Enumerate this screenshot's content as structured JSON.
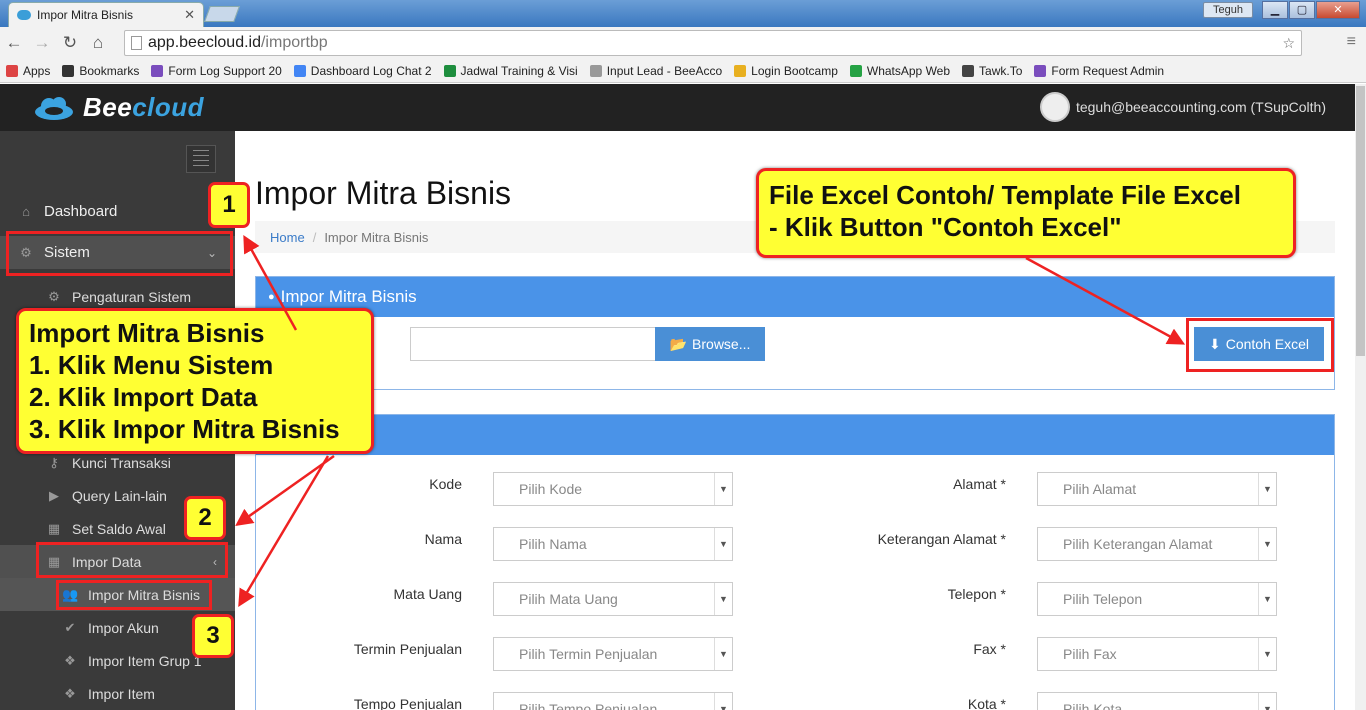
{
  "browser": {
    "tab_title": "Impor Mitra Bisnis",
    "tab_close": "✕",
    "window_user": "Teguh",
    "url_host": "app.beecloud.id",
    "url_path": "/importbp",
    "bookmarks": [
      {
        "label": "Apps",
        "icon": "apps-icon",
        "color": "#d44"
      },
      {
        "label": "Bookmarks",
        "icon": "star-icon",
        "color": "#333"
      },
      {
        "label": "Form Log Support 20",
        "icon": "form-icon",
        "color": "#7a4dbd"
      },
      {
        "label": "Dashboard Log Chat 2",
        "icon": "google-icon",
        "color": "#4285f4"
      },
      {
        "label": "Jadwal Training & Visi",
        "icon": "sheet-icon",
        "color": "#1e8e3e"
      },
      {
        "label": "Input Lead - BeeAcco",
        "icon": "page-icon",
        "color": "#999"
      },
      {
        "label": "Login Bootcamp",
        "icon": "hand-icon",
        "color": "#e8b020"
      },
      {
        "label": "WhatsApp Web",
        "icon": "whatsapp-icon",
        "color": "#25a244"
      },
      {
        "label": "Tawk.To",
        "icon": "bird-icon",
        "color": "#444"
      },
      {
        "label": "Form Request Admin",
        "icon": "form-icon",
        "color": "#7a4dbd"
      }
    ]
  },
  "app": {
    "logo_prefix": "Bee",
    "logo_suffix": "cloud",
    "user_email": "teguh@beeaccounting.com (TSupColth)"
  },
  "sidebar": {
    "items": [
      {
        "label": "Dashboard",
        "icon": "home-icon"
      },
      {
        "label": "Sistem",
        "icon": "gears-icon"
      },
      {
        "label": "Pengaturan Sistem",
        "icon": "gear-icon"
      },
      {
        "label": "Kunci Transaksi",
        "icon": "key-icon"
      },
      {
        "label": "Query Lain-lain",
        "icon": "play-icon"
      },
      {
        "label": "Set Saldo Awal",
        "icon": "table-icon"
      },
      {
        "label": "Impor Data",
        "icon": "table-icon"
      },
      {
        "label": "Impor Mitra Bisnis",
        "icon": "users-icon"
      },
      {
        "label": "Impor Akun",
        "icon": "check-icon"
      },
      {
        "label": "Impor Item Grup 1",
        "icon": "cubes-icon"
      },
      {
        "label": "Impor Item",
        "icon": "cubes-icon"
      }
    ]
  },
  "main": {
    "title": "Impor Mitra Bisnis",
    "breadcrumb_home": "Home",
    "breadcrumb_sep": "/",
    "breadcrumb_current": "Impor Mitra Bisnis",
    "panel_title": "Impor Mitra Bisnis",
    "browse_label": "Browse...",
    "contoh_label": "Contoh Excel",
    "fields_left": [
      {
        "label": "Kode",
        "placeholder": "Pilih Kode"
      },
      {
        "label": "Nama",
        "placeholder": "Pilih Nama"
      },
      {
        "label": "Mata Uang",
        "placeholder": "Pilih Mata Uang"
      },
      {
        "label": "Termin Penjualan",
        "placeholder": "Pilih Termin Penjualan"
      },
      {
        "label": "Tempo Penjualan",
        "placeholder": "Pilih Tempo Penjualan"
      }
    ],
    "fields_right": [
      {
        "label": "Alamat *",
        "placeholder": "Pilih Alamat"
      },
      {
        "label": "Keterangan Alamat *",
        "placeholder": "Pilih Keterangan Alamat"
      },
      {
        "label": "Telepon *",
        "placeholder": "Pilih Telepon"
      },
      {
        "label": "Fax *",
        "placeholder": "Pilih Fax"
      },
      {
        "label": "Kota *",
        "placeholder": "Pilih Kota"
      }
    ]
  },
  "annotations": {
    "import_title": "Import Mitra Bisnis",
    "import_step1": "1. Klik Menu Sistem",
    "import_step2": "2. Klik Import Data",
    "import_step3": "3. Klik Impor Mitra Bisnis",
    "excel_line1": "File Excel Contoh/ Template File Excel",
    "excel_line2": "- Klik Button \"Contoh Excel\"",
    "badge1": "1",
    "badge2": "2",
    "badge3": "3",
    "highlight_color": "#ffff33",
    "border_color": "#ee2222"
  }
}
